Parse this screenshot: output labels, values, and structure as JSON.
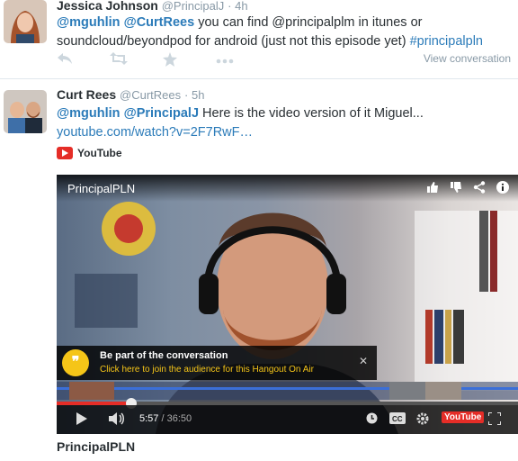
{
  "tweet1": {
    "name": "Jessica Johnson",
    "handle": "@PrincipalJ",
    "time": "· 4h",
    "mention1": "@mguhlin",
    "mention2": "@CurtRees",
    "text": " you can find @principalplm in itunes or soundcloud/beyondpod for android (just not this episode yet) ",
    "hashtag": "#principalpln",
    "view_conversation": "View conversation",
    "actions": [
      "reply-icon",
      "retweet-icon",
      "favorite-icon",
      "more-icon"
    ]
  },
  "tweet2": {
    "name": "Curt Rees",
    "handle": "@CurtRees",
    "time": "· 5h",
    "mention1": "@mguhlin",
    "mention2": "@PrincipalJ",
    "text": " Here is the video version of it Miguel...",
    "link": "youtube.com/watch?v=2F7RwF…",
    "card_source": "YouTube",
    "video": {
      "title": "PrincipalPLN",
      "banner_title": "Be part of the conversation",
      "banner_sub": "Click here to join the audience for this Hangout On Air",
      "current_time": "5:57",
      "duration": "/ 36:50",
      "progress_fraction": 0.162,
      "yt_badge": "YouTube"
    },
    "caption": "PrincipalPLN"
  }
}
